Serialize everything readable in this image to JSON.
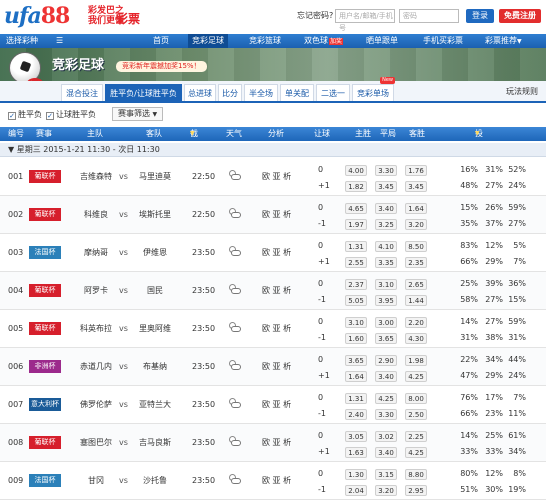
{
  "header": {
    "logo_text": "ufa",
    "logo_number": "88",
    "slogan": "彩发巴之\n我们更懂",
    "slogan_big": "彩票",
    "forgot_password": "忘记密码?",
    "username_placeholder": "用户名/邮箱/手机号",
    "password_placeholder": "密码",
    "login_label": "登录",
    "register_label": "免费注册"
  },
  "nav": {
    "lottery_selector": "选择彩种",
    "items": [
      {
        "label": "首页"
      },
      {
        "label": "竞彩足球"
      },
      {
        "label": "竞彩篮球"
      },
      {
        "label": "双色球",
        "badge": "加奖"
      },
      {
        "label": "晒单跟单"
      },
      {
        "label": "手机买彩票"
      },
      {
        "label": "彩票推荐",
        "arrow": "▼"
      }
    ],
    "active_index": 1
  },
  "banner": {
    "title": "竞彩足球",
    "promo": "竞彩新年震撼加奖15%！",
    "badge": "竞彩"
  },
  "tabs": [
    {
      "label": "混合投注"
    },
    {
      "label": "胜平负/让球胜平负"
    },
    {
      "label": "总进球"
    },
    {
      "label": "比分"
    },
    {
      "label": "半全场"
    },
    {
      "label": "单关配"
    },
    {
      "label": "二选一"
    },
    {
      "label": "竞彩单场",
      "new": "New"
    }
  ],
  "active_tab": 1,
  "rules_link": "玩法规则",
  "filters": {
    "opt1": "胜平负",
    "opt2": "让球胜平负",
    "match_filter": "赛事筛选",
    "arrow": "▼"
  },
  "table_header": {
    "num": "编号",
    "league": "赛事",
    "home": "主队",
    "away": "客队",
    "deadline": "截止",
    "deadline_sort": "▼",
    "weather": "天气",
    "analysis": "分析",
    "handicap": "让球",
    "win": "主胜",
    "draw": "平局",
    "lose": "客胜",
    "ratio": "投注比例",
    "ratio_sort": "▼"
  },
  "day_row": "▼ 星期三 2015-1-21 11:30 - 次日 11:30",
  "vs": "vs",
  "analysis_text": "欧 亚 析",
  "matches": [
    {
      "num": "001",
      "league": "葡联杯",
      "color": "#d61f2c",
      "home": "吉维森特",
      "away": "马里迪莫",
      "time": "22:50",
      "hc": [
        "0",
        "+1"
      ],
      "odds": [
        [
          "4.00",
          "3.30",
          "1.76"
        ],
        [
          "1.82",
          "3.45",
          "3.45"
        ]
      ],
      "pct": [
        [
          "16%",
          "31%",
          "52%"
        ],
        [
          "48%",
          "27%",
          "24%"
        ]
      ]
    },
    {
      "num": "002",
      "league": "葡联杯",
      "color": "#d61f2c",
      "home": "科维良",
      "away": "埃斯托里",
      "time": "22:50",
      "hc": [
        "0",
        "-1"
      ],
      "odds": [
        [
          "4.65",
          "3.40",
          "1.64"
        ],
        [
          "1.97",
          "3.25",
          "3.20"
        ]
      ],
      "pct": [
        [
          "15%",
          "26%",
          "59%"
        ],
        [
          "35%",
          "37%",
          "27%"
        ]
      ]
    },
    {
      "num": "003",
      "league": "法国杯",
      "color": "#2b80b9",
      "home": "摩纳哥",
      "away": "伊维恩",
      "time": "23:50",
      "hc": [
        "0",
        "+1"
      ],
      "odds": [
        [
          "1.31",
          "4.10",
          "8.50"
        ],
        [
          "2.55",
          "3.35",
          "2.35"
        ]
      ],
      "pct": [
        [
          "83%",
          "12%",
          "5%"
        ],
        [
          "66%",
          "29%",
          "7%"
        ]
      ]
    },
    {
      "num": "004",
      "league": "葡联杯",
      "color": "#d61f2c",
      "home": "阿罗卡",
      "away": "国民",
      "time": "23:50",
      "hc": [
        "0",
        "-1"
      ],
      "odds": [
        [
          "2.37",
          "3.10",
          "2.65"
        ],
        [
          "5.05",
          "3.95",
          "1.44"
        ]
      ],
      "pct": [
        [
          "25%",
          "39%",
          "36%"
        ],
        [
          "58%",
          "27%",
          "15%"
        ]
      ]
    },
    {
      "num": "005",
      "league": "葡联杯",
      "color": "#d61f2c",
      "home": "科英布拉",
      "away": "里奥阿维",
      "time": "23:50",
      "hc": [
        "0",
        "-1"
      ],
      "odds": [
        [
          "3.10",
          "3.00",
          "2.20"
        ],
        [
          "1.60",
          "3.65",
          "4.30"
        ]
      ],
      "pct": [
        [
          "14%",
          "27%",
          "59%"
        ],
        [
          "31%",
          "38%",
          "31%"
        ]
      ]
    },
    {
      "num": "006",
      "league": "非洲杯",
      "color": "#9c2a8c",
      "home": "赤道几内",
      "away": "布基纳",
      "time": "23:50",
      "hc": [
        "0",
        "+1"
      ],
      "odds": [
        [
          "3.65",
          "2.90",
          "1.98"
        ],
        [
          "1.64",
          "3.40",
          "4.25"
        ]
      ],
      "pct": [
        [
          "22%",
          "34%",
          "44%"
        ],
        [
          "47%",
          "29%",
          "24%"
        ]
      ]
    },
    {
      "num": "007",
      "league": "意大利杯",
      "color": "#1a5b98",
      "home": "佛罗伦萨",
      "away": "亚特兰大",
      "time": "23:50",
      "hc": [
        "0",
        "-1"
      ],
      "odds": [
        [
          "1.31",
          "4.25",
          "8.00"
        ],
        [
          "2.40",
          "3.30",
          "2.50"
        ]
      ],
      "pct": [
        [
          "76%",
          "17%",
          "7%"
        ],
        [
          "66%",
          "23%",
          "11%"
        ]
      ]
    },
    {
      "num": "008",
      "league": "葡联杯",
      "color": "#d61f2c",
      "home": "塞图巴尔",
      "away": "吉马良斯",
      "time": "23:50",
      "hc": [
        "0",
        "+1"
      ],
      "odds": [
        [
          "3.05",
          "3.02",
          "2.25"
        ],
        [
          "1.63",
          "3.40",
          "4.25"
        ]
      ],
      "pct": [
        [
          "14%",
          "25%",
          "61%"
        ],
        [
          "33%",
          "33%",
          "34%"
        ]
      ]
    },
    {
      "num": "009",
      "league": "法国杯",
      "color": "#2b80b9",
      "home": "甘冈",
      "away": "沙托鲁",
      "time": "23:50",
      "hc": [
        "0",
        "-1"
      ],
      "odds": [
        [
          "1.30",
          "3.15",
          "8.80"
        ],
        [
          "2.04",
          "3.20",
          "2.95"
        ]
      ],
      "pct": [
        [
          "80%",
          "12%",
          "8%"
        ],
        [
          "51%",
          "30%",
          "19%"
        ]
      ]
    }
  ],
  "colors": {
    "primary": "#1c63b7",
    "accent": "#e22d2d"
  }
}
